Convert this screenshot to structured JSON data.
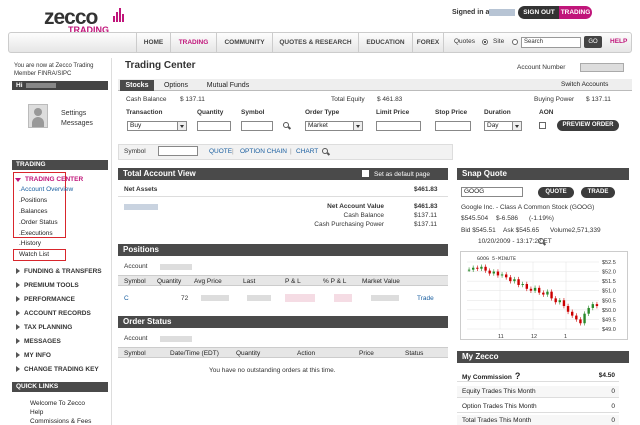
{
  "brand": {
    "name": "zecco",
    "sub": "TRADING"
  },
  "header": {
    "signed_in_as": "Signed in as",
    "sign_out": "SIGN OUT",
    "sign_out_mode": "TRADING",
    "nav": [
      "HOME",
      "TRADING",
      "COMMUNITY",
      "QUOTES & RESEARCH",
      "EDUCATION",
      "FOREX"
    ],
    "nav_active": "TRADING",
    "quotes_label": "Quotes",
    "site_label": "Site",
    "search_placeholder": "Search",
    "search_btn": "GO",
    "help": "HELP"
  },
  "sidebar": {
    "you_are_now": "You are now at Zecco Trading Member FINRA/SIPC",
    "hi": "Hi",
    "settings": "Settings",
    "messages": "Messages",
    "trading_header": "TRADING",
    "trading_center": "TRADING CENTER",
    "trading_sub": [
      ".Account Overview",
      ".Positions",
      ".Balances",
      ".Order Status",
      ".Executions",
      ".History",
      "Watch List"
    ],
    "nav": [
      "FUNDING & TRANSFERS",
      "PREMIUM TOOLS",
      "PERFORMANCE",
      "ACCOUNT RECORDS",
      "TAX PLANNING",
      "MESSAGES",
      "MY INFO",
      "CHANGE TRADING KEY"
    ],
    "quick_links_header": "QUICK LINKS",
    "quick_links": [
      "Welcome To Zecco",
      "Help",
      "Commissions & Fees"
    ]
  },
  "trading_center": {
    "title": "Trading Center",
    "account_number_label": "Account Number",
    "tabs": [
      "Stocks",
      "Options",
      "Mutual Funds"
    ],
    "switch_accounts": "Switch Accounts",
    "cash_balance_label": "Cash Balance",
    "cash_balance": "$ 137.11",
    "total_equity_label": "Total Equity",
    "total_equity": "$ 461.83",
    "buying_power_label": "Buying Power",
    "buying_power": "$ 137.11",
    "cols": [
      "Transaction",
      "Quantity",
      "Symbol",
      "Order Type",
      "Limit Price",
      "Stop Price",
      "Duration",
      "AON"
    ],
    "transaction": "Buy",
    "order_type": "Market",
    "duration": "Day",
    "preview": "PREVIEW ORDER",
    "symbol_label": "Symbol",
    "quote_links": [
      "QUOTE",
      "OPTION CHAIN",
      "CHART"
    ]
  },
  "total_account": {
    "title": "Total Account View",
    "default_label": "Set as default page",
    "net_assets_label": "Net Assets",
    "net_assets": "$461.83",
    "rows": [
      {
        "label": "Net Account Value",
        "value": "$461.83"
      },
      {
        "label": "Cash Balance",
        "value": "$137.11"
      },
      {
        "label": "Cash Purchasing Power",
        "value": "$137.11"
      }
    ]
  },
  "positions": {
    "title": "Positions",
    "account_label": "Account",
    "cols": [
      "Symbol",
      "Quantity",
      "Avg Price",
      "Last",
      "P & L",
      "% P & L",
      "Market Value"
    ],
    "row": {
      "symbol": "C",
      "quantity": "72",
      "action": "Trade"
    }
  },
  "order_status": {
    "title": "Order Status",
    "account_label": "Account",
    "cols": [
      "Symbol",
      "Date/Time (EDT)",
      "Quantity",
      "Action",
      "Price",
      "Status"
    ],
    "empty": "You have no outstanding orders at this time."
  },
  "snap_quote": {
    "title": "Snap Quote",
    "symbol": "GOOG",
    "quote_btn": "QUOTE",
    "trade_btn": "TRADE",
    "company": "Google Inc. - Class A Common Stock (GOOG)",
    "last": "$545.504",
    "change": "$-6.586",
    "change_pct": "(-1.19%)",
    "bid": "Bid $545.51",
    "ask": "Ask $545.65",
    "volume": "Volume2,571,339",
    "timestamp": "10/20/2009 - 13:17:22 ET",
    "chart_label": "GOOG  5-MINUTE",
    "y_ticks": [
      "$52.5",
      "$52.0",
      "$51.5",
      "$51.0",
      "$50.5",
      "$50.0",
      "$49.5",
      "$49.0"
    ],
    "x_ticks": [
      "11",
      "12",
      "1"
    ],
    "accent": "#cc0000"
  },
  "my_zecco": {
    "title": "My Zecco",
    "commission_label": "My Commission",
    "commission_icon": "question-icon",
    "commission": "$4.50",
    "rows": [
      {
        "label": "Equity Trades This Month",
        "value": "0"
      },
      {
        "label": "Option Trades This Month",
        "value": "0"
      },
      {
        "label": "Total Trades This Month",
        "value": "0"
      }
    ]
  },
  "chart_data": {
    "type": "line",
    "title": "GOOG 5-MINUTE",
    "x_ticks": [
      "11",
      "12",
      "1"
    ],
    "ylim": [
      49.0,
      52.5
    ],
    "candles": [
      52.1,
      52.2,
      52.15,
      52.25,
      52.05,
      51.9,
      52.0,
      51.8,
      51.85,
      51.7,
      51.5,
      51.6,
      51.3,
      51.35,
      51.1,
      51.0,
      51.15,
      50.9,
      50.8,
      50.95,
      50.6,
      50.4,
      50.5,
      50.2,
      49.9,
      49.7,
      49.5,
      49.3,
      49.8,
      50.1,
      50.3,
      50.2
    ]
  }
}
